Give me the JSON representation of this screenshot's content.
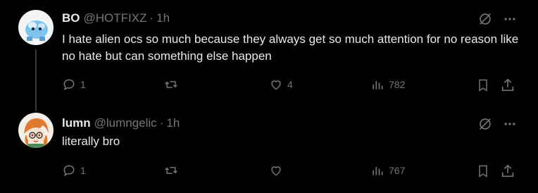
{
  "posts": [
    {
      "name": "BO",
      "handle": "@HOTFIXZ",
      "separator": "·",
      "time": "1h",
      "text": "I hate alien ocs so much because they always get so much attention for no reason like no hate but can something else happen",
      "replies": "1",
      "reposts": "",
      "likes": "4",
      "views": "782"
    },
    {
      "name": "lumn",
      "handle": "@lumngelic",
      "separator": "·",
      "time": "1h",
      "text": "literally bro",
      "replies": "1",
      "reposts": "",
      "likes": "",
      "views": "767"
    }
  ],
  "icons": {
    "reply": "reply-icon",
    "repost": "repost-icon",
    "like": "heart-icon",
    "views": "views-icon",
    "bookmark": "bookmark-icon",
    "share": "share-icon",
    "grok": "grok-icon",
    "more": "more-icon"
  },
  "colors": {
    "background": "#000000",
    "text": "#e7e9ea",
    "muted": "#71767b",
    "thread_line": "#333639"
  }
}
